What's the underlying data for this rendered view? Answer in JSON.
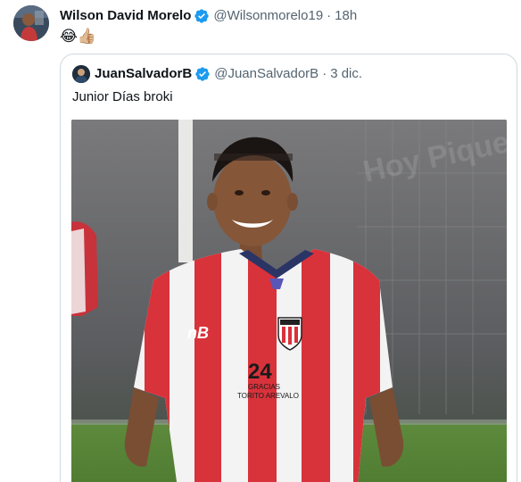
{
  "tweet": {
    "author": {
      "name": "Wilson David Morelo",
      "handle": "@Wilsonmorelo19",
      "verified": true
    },
    "time": "18h",
    "separator": "·",
    "text": "😂👍🏼"
  },
  "quoted": {
    "author": {
      "name": "JuanSalvadorB",
      "handle": "@JuanSalvadorB",
      "verified": true
    },
    "separator": "·",
    "time": "3 dic.",
    "text": "Junior Días broki",
    "photo": {
      "jersey_number": "24",
      "jersey_text_line1": "GRACIAS",
      "jersey_text_line2": "TORITO AREVALO",
      "watermark": "Hoy Pique Sport"
    }
  },
  "colors": {
    "verified": "#1d9bf0",
    "secondary_text": "#536471",
    "border": "#cfd9de",
    "jersey_red": "#d8323b"
  }
}
